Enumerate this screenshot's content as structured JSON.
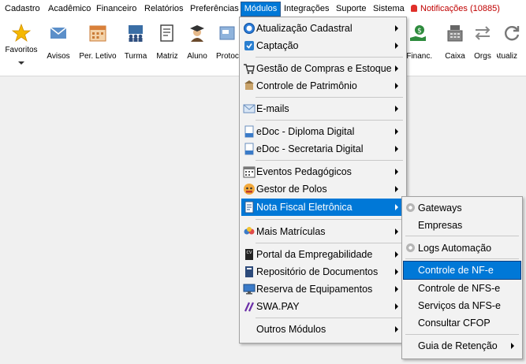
{
  "menubar": {
    "items": [
      {
        "label": "Cadastro"
      },
      {
        "label": "Acadêmico"
      },
      {
        "label": "Financeiro"
      },
      {
        "label": "Relatórios"
      },
      {
        "label": "Preferências"
      },
      {
        "label": "Módulos"
      },
      {
        "label": "Integrações"
      },
      {
        "label": "Suporte"
      },
      {
        "label": "Sistema"
      }
    ],
    "notifications": "Notificações (10885)"
  },
  "toolbar": {
    "left": [
      {
        "label": "Favoritos",
        "icon": "star-icon",
        "color": "#f5b800"
      },
      {
        "label": "Avisos",
        "icon": "envelope-icon",
        "color": "#4a7fb8"
      },
      {
        "label": "Per. Letivo",
        "icon": "calendar-icon",
        "color": "#d9803a"
      },
      {
        "label": "Turma",
        "icon": "classroom-icon",
        "color": "#2f4f7f"
      },
      {
        "label": "Matriz",
        "icon": "document-icon",
        "color": "#3b3b3b"
      },
      {
        "label": "Aluno",
        "icon": "graduate-icon",
        "color": "#6b4a2c"
      },
      {
        "label": "Protoc",
        "icon": "protocol-icon",
        "color": "#5a7fb0"
      }
    ],
    "right": [
      {
        "label": "rl Financ.",
        "icon": "money-hand-icon",
        "color": "#2e8b3d"
      },
      {
        "label": "Caixa",
        "icon": "cash-register-icon",
        "color": "#555555"
      },
      {
        "label": "Orgs",
        "icon": "swap-arrows-icon",
        "color": "#888888"
      },
      {
        "label": "Atualiz",
        "icon": "refresh-icon",
        "color": "#777777"
      }
    ]
  },
  "modulos_menu": {
    "items": [
      {
        "label": "Atualização Cadastral",
        "icon": "update-icon"
      },
      {
        "label": "Captação",
        "icon": "capture-icon"
      },
      {
        "label": "Gestão de Compras e Estoque",
        "icon": "purchases-icon"
      },
      {
        "label": "Controle de Patrimônio",
        "icon": "patrimony-icon"
      },
      {
        "label": "E-mails",
        "icon": "email-icon"
      },
      {
        "label": "eDoc - Diploma Digital",
        "icon": "edoc-icon"
      },
      {
        "label": "eDoc - Secretaria Digital",
        "icon": "edoc-icon"
      },
      {
        "label": "Eventos Pedagógicos",
        "icon": "events-icon"
      },
      {
        "label": "Gestor de Polos",
        "icon": "poles-icon"
      },
      {
        "label": "Nota Fiscal Eletrônica",
        "icon": "invoice-icon"
      },
      {
        "label": "Mais Matrículas",
        "icon": "enrollment-icon"
      },
      {
        "label": "Portal da Empregabilidade",
        "icon": "cv-icon"
      },
      {
        "label": "Repositório de Documentos",
        "icon": "book-icon"
      },
      {
        "label": "Reserva de Equipamentos",
        "icon": "monitor-icon"
      },
      {
        "label": "SWA.PAY",
        "icon": "swapay-icon"
      },
      {
        "label": "Outros Módulos",
        "icon": ""
      }
    ]
  },
  "nfe_submenu": {
    "items": [
      {
        "label": "Gateways"
      },
      {
        "label": "Empresas"
      },
      {
        "label": "Logs Automação"
      },
      {
        "label": "Controle de NF-e"
      },
      {
        "label": "Controle de NFS-e"
      },
      {
        "label": "Serviços da NFS-e"
      },
      {
        "label": "Consultar CFOP"
      },
      {
        "label": "Guia de Retenção"
      }
    ]
  }
}
